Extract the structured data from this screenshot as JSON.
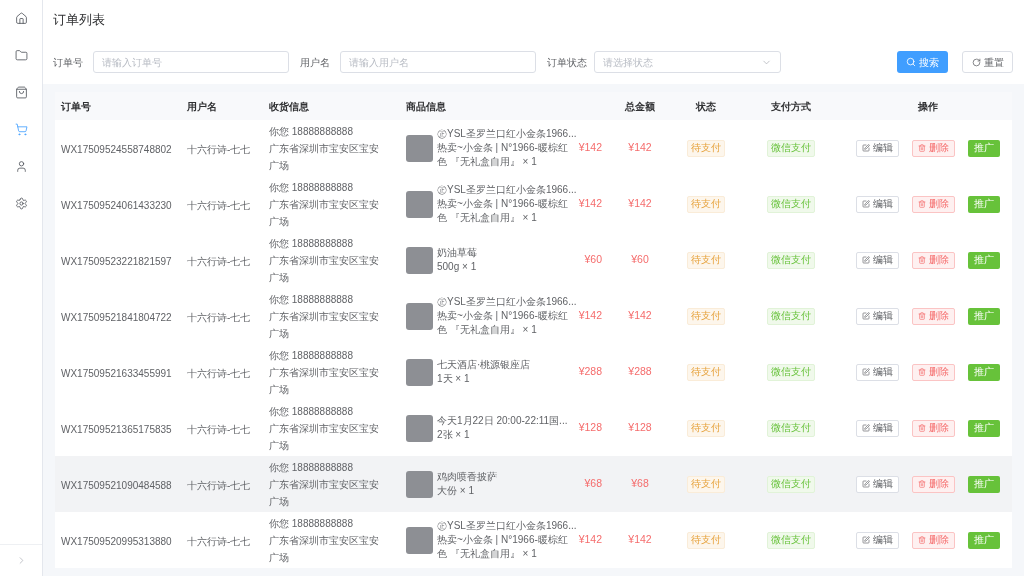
{
  "sidebar": {
    "items": [
      {
        "selected": false
      },
      {
        "selected": false
      },
      {
        "selected": false
      },
      {
        "selected": true
      },
      {
        "selected": false
      },
      {
        "selected": false
      }
    ]
  },
  "page_title": "订单列表",
  "filters": [
    {
      "kind": "input",
      "label": "订单号",
      "placeholder": "请输入订单号"
    },
    {
      "kind": "input",
      "label": "用户名",
      "placeholder": "请输入用户名"
    },
    {
      "kind": "select",
      "label": "订单状态",
      "placeholder": "请选择状态"
    }
  ],
  "filter_buttons": [
    {
      "kind": "search",
      "label": "搜索"
    },
    {
      "kind": "reset",
      "label": "重置"
    }
  ],
  "table": {
    "columns": [
      "订单号",
      "用户名",
      "收货信息",
      "商品信息",
      "总金额",
      "状态",
      "支付方式",
      "操作"
    ],
    "rows": [
      {
        "order_no": "WX17509524558748802",
        "user": "十六行诗-七七",
        "contact": "你您 18888888888",
        "address": "广东省深圳市宝安区宝安广场",
        "product": {
          "name": "㊣YSL圣罗兰口红小金条1966...",
          "spec": "热卖~小金条 | N°1966-暖棕红色 『无礼盒自用』 × 1",
          "price": "¥142"
        },
        "total": "¥142",
        "status": "待支付",
        "payment": "微信支付",
        "actions": [
          {
            "kind": "edit",
            "label": "编辑"
          },
          {
            "kind": "delete",
            "label": "删除"
          },
          {
            "kind": "promote",
            "label": "推广"
          }
        ],
        "highlighted": false
      },
      {
        "order_no": "WX17509524061433230",
        "user": "十六行诗-七七",
        "contact": "你您 18888888888",
        "address": "广东省深圳市宝安区宝安广场",
        "product": {
          "name": "㊣YSL圣罗兰口红小金条1966...",
          "spec": "热卖~小金条 | N°1966-暖棕红色 『无礼盒自用』 × 1",
          "price": "¥142"
        },
        "total": "¥142",
        "status": "待支付",
        "payment": "微信支付",
        "actions": [
          {
            "kind": "edit",
            "label": "编辑"
          },
          {
            "kind": "delete",
            "label": "删除"
          },
          {
            "kind": "promote",
            "label": "推广"
          }
        ],
        "highlighted": false
      },
      {
        "order_no": "WX17509523221821597",
        "user": "十六行诗-七七",
        "contact": "你您 18888888888",
        "address": "广东省深圳市宝安区宝安广场",
        "product": {
          "name": "奶油草莓",
          "spec": "500g × 1",
          "price": "¥60"
        },
        "total": "¥60",
        "status": "待支付",
        "payment": "微信支付",
        "actions": [
          {
            "kind": "edit",
            "label": "编辑"
          },
          {
            "kind": "delete",
            "label": "删除"
          },
          {
            "kind": "promote",
            "label": "推广"
          }
        ],
        "highlighted": false
      },
      {
        "order_no": "WX17509521841804722",
        "user": "十六行诗-七七",
        "contact": "你您 18888888888",
        "address": "广东省深圳市宝安区宝安广场",
        "product": {
          "name": "㊣YSL圣罗兰口红小金条1966...",
          "spec": "热卖~小金条 | N°1966-暖棕红色 『无礼盒自用』 × 1",
          "price": "¥142"
        },
        "total": "¥142",
        "status": "待支付",
        "payment": "微信支付",
        "actions": [
          {
            "kind": "edit",
            "label": "编辑"
          },
          {
            "kind": "delete",
            "label": "删除"
          },
          {
            "kind": "promote",
            "label": "推广"
          }
        ],
        "highlighted": false
      },
      {
        "order_no": "WX17509521633455991",
        "user": "十六行诗-七七",
        "contact": "你您 18888888888",
        "address": "广东省深圳市宝安区宝安广场",
        "product": {
          "name": "七天酒店·桃源银座店",
          "spec": "1天 × 1",
          "price": "¥288"
        },
        "total": "¥288",
        "status": "待支付",
        "payment": "微信支付",
        "actions": [
          {
            "kind": "edit",
            "label": "编辑"
          },
          {
            "kind": "delete",
            "label": "删除"
          },
          {
            "kind": "promote",
            "label": "推广"
          }
        ],
        "highlighted": false
      },
      {
        "order_no": "WX17509521365175835",
        "user": "十六行诗-七七",
        "contact": "你您 18888888888",
        "address": "广东省深圳市宝安区宝安广场",
        "product": {
          "name": "今天1月22日 20:00-22:11国...",
          "spec": "2张 × 1",
          "price": "¥128"
        },
        "total": "¥128",
        "status": "待支付",
        "payment": "微信支付",
        "actions": [
          {
            "kind": "edit",
            "label": "编辑"
          },
          {
            "kind": "delete",
            "label": "删除"
          },
          {
            "kind": "promote",
            "label": "推广"
          }
        ],
        "highlighted": false
      },
      {
        "order_no": "WX17509521090484588",
        "user": "十六行诗-七七",
        "contact": "你您 18888888888",
        "address": "广东省深圳市宝安区宝安广场",
        "product": {
          "name": "鸡肉喷香披萨",
          "spec": "大份 × 1",
          "price": "¥68"
        },
        "total": "¥68",
        "status": "待支付",
        "payment": "微信支付",
        "actions": [
          {
            "kind": "edit",
            "label": "编辑"
          },
          {
            "kind": "delete",
            "label": "删除"
          },
          {
            "kind": "promote",
            "label": "推广"
          }
        ],
        "highlighted": true
      },
      {
        "order_no": "WX17509520995313880",
        "user": "十六行诗-七七",
        "contact": "你您 18888888888",
        "address": "广东省深圳市宝安区宝安广场",
        "product": {
          "name": "㊣YSL圣罗兰口红小金条1966...",
          "spec": "热卖~小金条 | N°1966-暖棕红色 『无礼盒自用』 × 1",
          "price": "¥142"
        },
        "total": "¥142",
        "status": "待支付",
        "payment": "微信支付",
        "actions": [
          {
            "kind": "edit",
            "label": "编辑"
          },
          {
            "kind": "delete",
            "label": "删除"
          },
          {
            "kind": "promote",
            "label": "推广"
          }
        ],
        "highlighted": false
      }
    ]
  }
}
